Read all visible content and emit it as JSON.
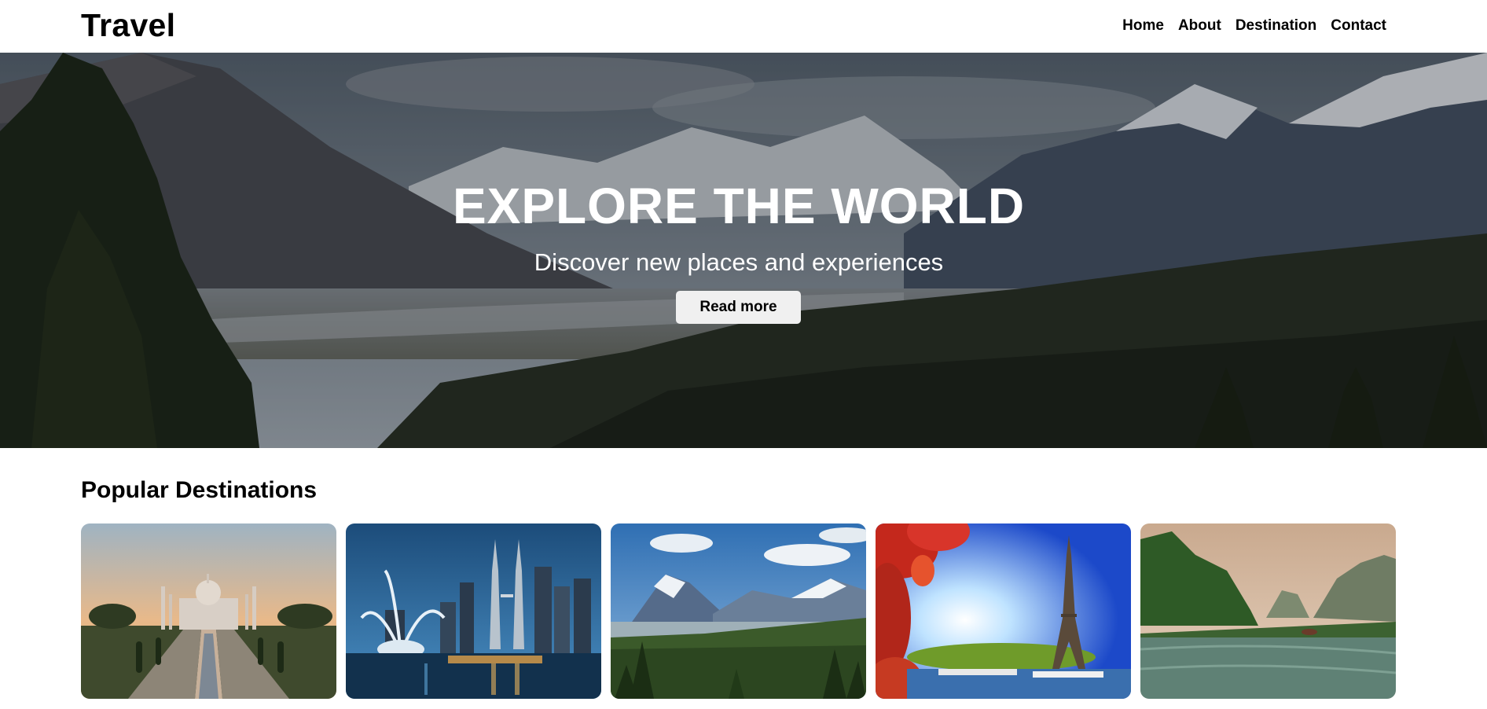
{
  "header": {
    "brand": "Travel",
    "nav": [
      "Home",
      "About",
      "Destination",
      "Contact"
    ]
  },
  "hero": {
    "title": "EXPLORE THE WORLD",
    "subtitle": "Discover new places and experiences",
    "button_label": "Read more"
  },
  "destinations": {
    "title": "Popular Destinations",
    "cards": [
      {
        "scene": "taj-mahal"
      },
      {
        "scene": "city-skyline-fountain"
      },
      {
        "scene": "mountain-valley"
      },
      {
        "scene": "eiffel-tower"
      },
      {
        "scene": "river-cliffs"
      }
    ]
  },
  "colors": {
    "header_bg": "#ffffff",
    "button_bg": "#f0f0f0",
    "text": "#000000"
  }
}
